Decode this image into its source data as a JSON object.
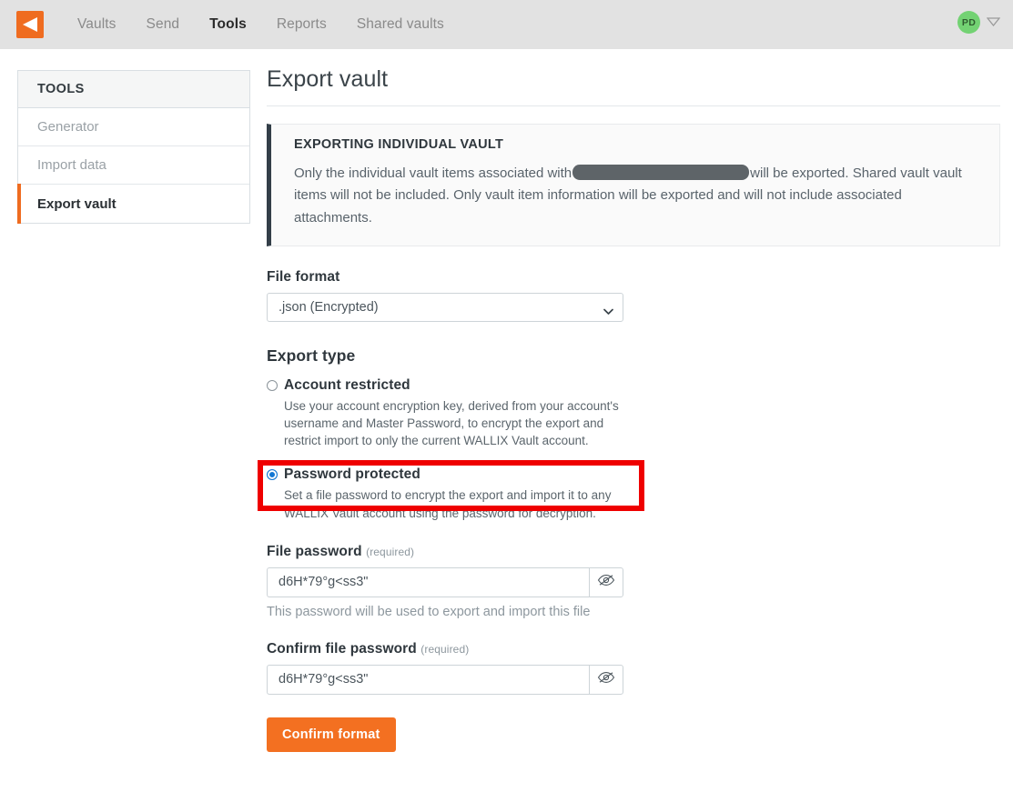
{
  "topnav": {
    "logo_icon": "wallix-logo-icon",
    "links": [
      {
        "label": "Vaults",
        "active": false
      },
      {
        "label": "Send",
        "active": false
      },
      {
        "label": "Tools",
        "active": true
      },
      {
        "label": "Reports",
        "active": false
      },
      {
        "label": "Shared vaults",
        "active": false
      }
    ],
    "account": {
      "initials": "PD",
      "caret_icon": "chevron-down-icon"
    }
  },
  "sidebar": {
    "header": "TOOLS",
    "items": [
      {
        "label": "Generator",
        "active": false
      },
      {
        "label": "Import data",
        "active": false
      },
      {
        "label": "Export vault",
        "active": true
      }
    ]
  },
  "main": {
    "title": "Export vault",
    "notice": {
      "title": "EXPORTING INDIVIDUAL VAULT",
      "text_before": "Only the individual vault items associated with",
      "redacted": "",
      "text_after": "will be exported. Shared vault vault items will not be included. Only vault item information will be exported and will not include associated attachments."
    },
    "file_format": {
      "label": "File format",
      "selected": ".json (Encrypted)",
      "chevron_icon": "chevron-down-icon",
      "highlight_color": "#ef0000"
    },
    "export_type": {
      "label": "Export type",
      "options": [
        {
          "label": "Account restricted",
          "checked": false,
          "description": "Use your account encryption key, derived from your account's username and Master Password, to encrypt the export and restrict import to only the current WALLIX Vault account."
        },
        {
          "label": "Password protected",
          "checked": true,
          "description": "Set a file password to encrypt the export and import it to any WALLIX Vault account using the password for decryption."
        }
      ]
    },
    "file_password": {
      "label": "File password",
      "required_note": "(required)",
      "value": "d6H*79°g<ss3\"",
      "toggle_icon": "eye-slash-icon",
      "help": "This password will be used to export and import this file"
    },
    "confirm_file_password": {
      "label": "Confirm file password",
      "required_note": "(required)",
      "value": "d6H*79°g<ss3\"",
      "toggle_icon": "eye-slash-icon"
    },
    "confirm_button": {
      "label": "Confirm format",
      "color": "#f37021"
    }
  }
}
